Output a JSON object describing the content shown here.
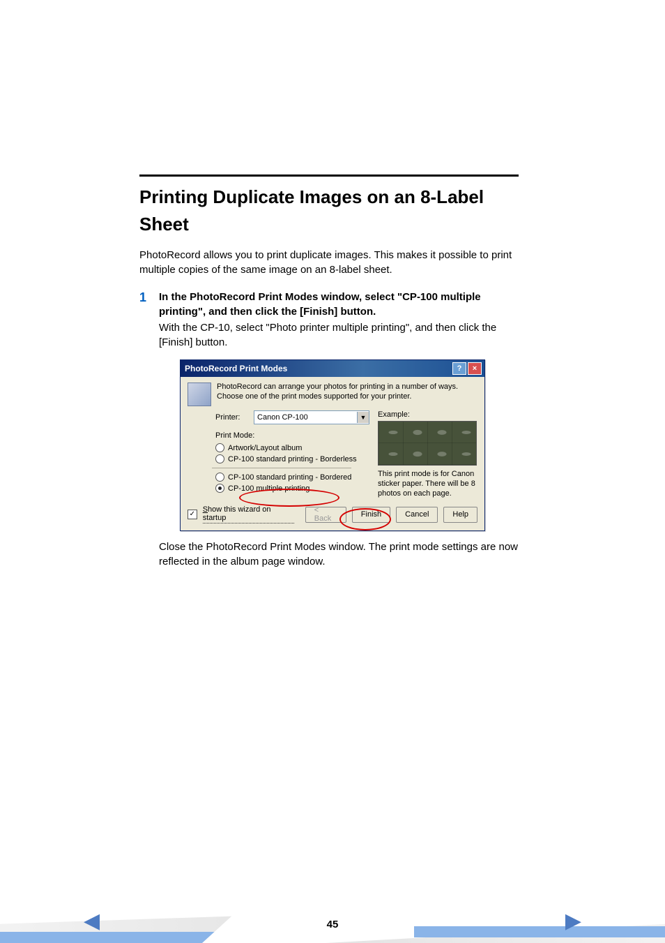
{
  "heading": "Printing Duplicate Images on an 8-Label Sheet",
  "intro": "PhotoRecord allows you to print duplicate images. This makes it possible to print multiple copies of the same image on an 8-label sheet.",
  "step": {
    "num": "1",
    "title": "In the PhotoRecord Print Modes window, select \"CP-100 multiple printing\", and then click the [Finish] button.",
    "detail": "With the CP-10, select \"Photo printer multiple printing\", and then click the [Finish] button."
  },
  "dialog": {
    "title": "PhotoRecord Print Modes",
    "help_btn": "?",
    "close_btn": "×",
    "description": "PhotoRecord can arrange your photos for printing in a number of ways. Choose one of the print modes supported for your printer.",
    "printer_label": "Printer:",
    "printer_value": "Canon CP-100",
    "print_mode_label": "Print Mode:",
    "options": {
      "o1": "Artwork/Layout album",
      "o2": "CP-100 standard printing - Borderless",
      "o3": "CP-100 standard printing - Bordered",
      "o4": "CP-100 multiple printing"
    },
    "example_label": "Example:",
    "example_note": "This print mode is for Canon sticker paper. There will be 8 photos on each page.",
    "checkbox_label": "Show this wizard on startup",
    "checkbox_checked": "✓",
    "buttons": {
      "back": "< Back",
      "finish": "Finish",
      "cancel": "Cancel",
      "help": "Help"
    }
  },
  "after_dialog": "Close the PhotoRecord Print Modes window. The print mode settings are now reflected in the album page window.",
  "footer": {
    "page": "45",
    "prev": "◀",
    "next": "▶"
  }
}
